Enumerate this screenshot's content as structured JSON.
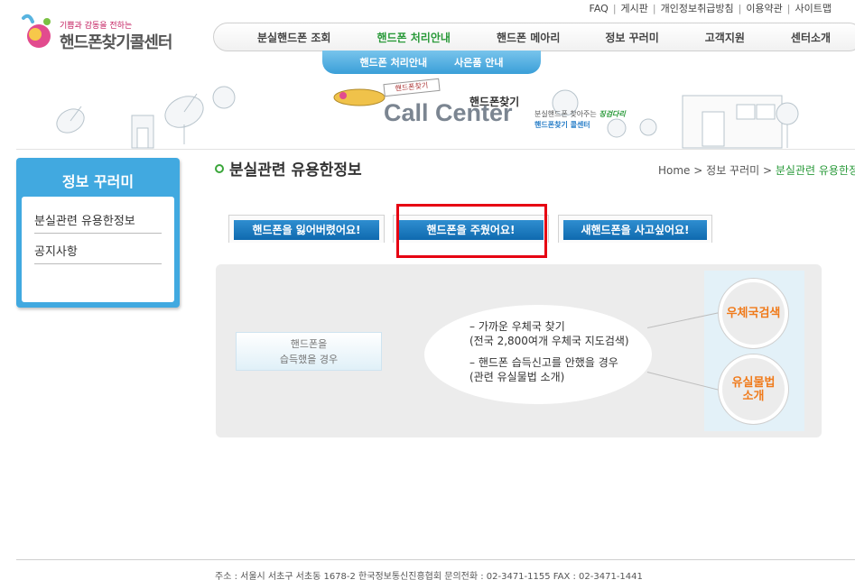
{
  "util_links": [
    "FAQ",
    "게시판",
    "개인정보취급방침",
    "이용약관",
    "사이트맵"
  ],
  "logo": {
    "slogan": "기쁨과 감동을 전하는",
    "name": "핸드폰찾기콜센터"
  },
  "gnb": [
    "분실핸드폰 조회",
    "핸드폰 처리안내",
    "핸드폰 메아리",
    "정보 꾸러미",
    "고객지원",
    "센터소개"
  ],
  "gnb_active": "핸드폰 처리안내",
  "subnav": [
    "핸드폰 처리안내",
    "사은품 안내"
  ],
  "banner": {
    "flag": "핸드폰찾기",
    "subtitle": "핸드폰찾기",
    "title": "Call Center",
    "desc1_prefix": "분실핸드폰 찾아주는 ",
    "desc1_em": "징검다리",
    "desc2": "핸드폰찾기 콜센터"
  },
  "sidebar": {
    "title": "정보 꾸러미",
    "items": [
      "분실관련 유용한정보",
      "공지사항"
    ]
  },
  "page_title": "분실관련 유용한정보",
  "breadcrumb": {
    "home": "Home",
    "sep": ">",
    "level1": "정보 꾸러미",
    "current": "분실관련 유용한정보"
  },
  "tabs": [
    "핸드폰을 잃어버렸어요!",
    "핸드폰을 주웠어요!",
    "새핸드폰을 사고싶어요!"
  ],
  "content": {
    "case_line1": "핸드폰을",
    "case_line2": "습득했을 경우",
    "info": [
      "– 가까운 우체국 찾기",
      "(전국 2,800여개 우체국 지도검색)",
      "– 핸드폰 습득신고를 안했을 경우",
      "(관련 유실물법 소개)"
    ],
    "btn_post": "우체국검색",
    "btn_law_1": "유실물법",
    "btn_law_2": "소개"
  },
  "footer": "주소 : 서울시 서초구 서초동 1678-2  한국정보통신진흥협회  문의전화 : 02-3471-1155  FAX : 02-3471-1441",
  "colors": {
    "accent_green": "#2a9a3a",
    "accent_blue": "#41a9e0",
    "highlight_red": "#e60012",
    "orange": "#f07a1a"
  }
}
